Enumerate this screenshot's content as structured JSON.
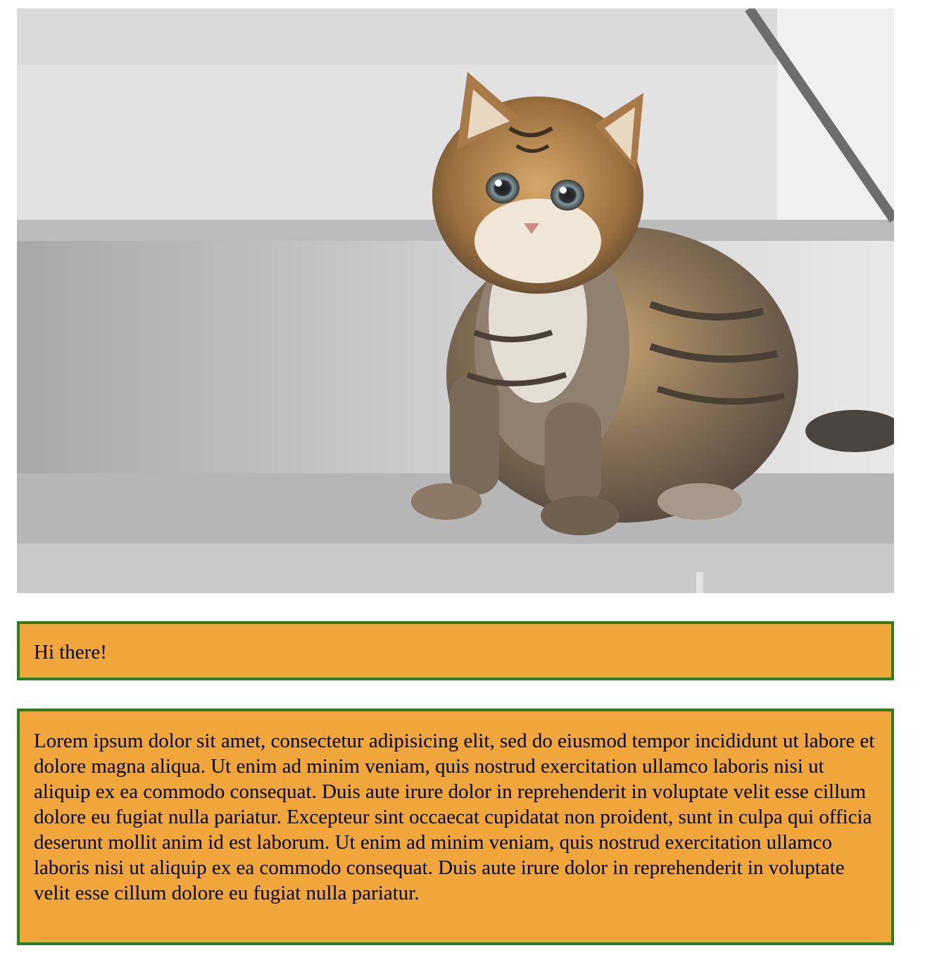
{
  "colors": {
    "box_background": "#f0a63a",
    "box_border": "#2f7d1f",
    "page_background": "#ffffff"
  },
  "photo": {
    "subject": "kitten-on-stairs"
  },
  "greeting_box": {
    "text": "Hi there!"
  },
  "lorem_box": {
    "text": "Lorem ipsum dolor sit amet, consectetur adipisicing elit, sed do eiusmod tempor incididunt ut labore et dolore magna aliqua. Ut enim ad minim veniam, quis nostrud exercitation ullamco laboris nisi ut aliquip ex ea commodo consequat. Duis aute irure dolor in reprehenderit in voluptate velit esse cillum dolore eu fugiat nulla pariatur. Excepteur sint occaecat cupidatat non proident, sunt in culpa qui officia deserunt mollit anim id est laborum. Ut enim ad minim veniam, quis nostrud exercitation ullamco laboris nisi ut aliquip ex ea commodo consequat. Duis aute irure dolor in reprehenderit in voluptate velit esse cillum dolore eu fugiat nulla pariatur."
  }
}
